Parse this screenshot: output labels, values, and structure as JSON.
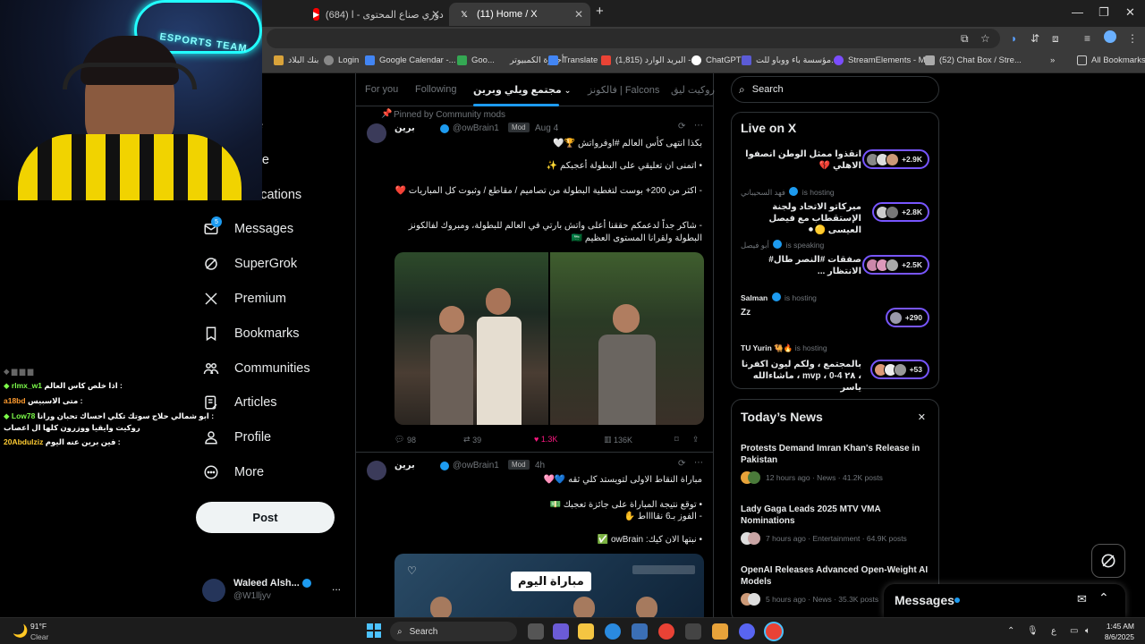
{
  "browser": {
    "tabs": [
      {
        "label": "(684) دوري صناع المحتوى - ا",
        "icon": "youtube-icon"
      },
      {
        "label": "(11) Home / X",
        "icon": "x-logo-icon"
      }
    ],
    "new_tab": "+",
    "bookmarks": [
      "بنك البلاد",
      "Login",
      "Google Calendar -...",
      "Goo...",
      "أجهزة الكمبيوتر",
      "Translate",
      "البريد الوارد (1,815) -...",
      "ChatGPT",
      "مؤسسة باء ووباو للت...",
      "StreamElements - M...",
      "(52) Chat Box / Stre...",
      "»",
      "All Bookmarks"
    ]
  },
  "nav": {
    "partial_items": [
      "e",
      "re",
      "ications"
    ],
    "items": [
      {
        "label": "Messages",
        "icon": "mail-icon",
        "badge": "5"
      },
      {
        "label": "SuperGrok",
        "icon": "grok-icon"
      },
      {
        "label": "Premium",
        "icon": "x-logo-icon"
      },
      {
        "label": "Bookmarks",
        "icon": "bookmark-icon"
      },
      {
        "label": "Communities",
        "icon": "communities-icon"
      },
      {
        "label": "Articles",
        "icon": "articles-icon"
      },
      {
        "label": "Profile",
        "icon": "profile-icon"
      },
      {
        "label": "More",
        "icon": "more-circle-icon"
      }
    ],
    "post_label": "Post",
    "account": {
      "name": "Waleed Alsh...",
      "handle": "@W1lljyv",
      "menu": "..."
    }
  },
  "feed": {
    "tabs": [
      "For you",
      "Following",
      "مجتمع ويلي وبرين",
      "فالكونز | Falcons",
      "روكيت ليق"
    ],
    "tweets": [
      {
        "pinned_label": "Pinned by Community mods",
        "name": "برين",
        "handle": "@owBrain1",
        "mod": "Mod",
        "time": "Aug 4",
        "lines": [
          "بكذا انتهى كأس العالم #اوفرواتش 🏆🤍",
          "• اتمنى ان تعليقي على البطولة أعجبكم ✨",
          "- اكثر من 200+ بوست لتغطية البطولة من تصاميم / مقاطع / وثبوت كل المباريات ❤️",
          "- شاكر جداً لدعمكم حققنا أعلى واتش بارتي في العالم للبطولة، ومبروك لفالكونز",
          "البطولة ولقرانا المستوى العظيم 🇸🇦"
        ],
        "replies": "98",
        "reposts": "39",
        "likes": "1.3K",
        "views": "136K"
      },
      {
        "name": "برين",
        "handle": "@owBrain1",
        "mod": "Mod",
        "time": "4h",
        "lines": [
          "مباراة النقاط الاولى لتويستد كلي ثقه 💙🩷",
          "• توقع نتيجة المباراة على جائزة تعجبك 💵",
          "- الفوز بـ6 نقااااط ✋",
          "• نبتها الان كيك: owBrain ✅"
        ],
        "card_title": "مباراة اليوم"
      }
    ]
  },
  "sidebar": {
    "search_placeholder": "Search",
    "live": {
      "title": "Live on X",
      "items": [
        {
          "host": "",
          "status": "",
          "title": "انقذوا ممثل الوطن انصفوا الاهلي 💔",
          "count": "+2.9K"
        },
        {
          "host": "فهد السحيباني",
          "status": "is hosting",
          "title": "ميركاتو الاتحاد ولجنة الإستقطاب مع فيصل العيسى 🟡⚫",
          "count": "+2.8K"
        },
        {
          "host": "أبو فيصل",
          "status": "is speaking",
          "title": "صفقات #النصر طال# الانتظار ...",
          "count": "+2.5K"
        },
        {
          "host": "Salman",
          "status": "is hosting",
          "title": "Zz",
          "count": "+290"
        },
        {
          "host": "TU Yurin 🐫🔥",
          "status": "is hosting",
          "title": "بالمجتمع ، ولكم ليون اكفرنا ، ٢٨ 4-0 ، mvp ، ماشاءالله ياسر",
          "count": "+53"
        }
      ]
    },
    "news": {
      "title": "Today’s News",
      "close": "✕",
      "items": [
        {
          "title": "Protests Demand Imran Khan's Release in Pakistan",
          "meta": "12 hours ago · News · 41.2K posts"
        },
        {
          "title": "Lady Gaga Leads 2025 MTV VMA Nominations",
          "meta": "7 hours ago · Entertainment · 64.9K posts"
        },
        {
          "title": "OpenAI Releases Advanced Open-Weight AI Models",
          "meta": "5 hours ago · News · 35.3K posts"
        }
      ]
    }
  },
  "messages_drawer": {
    "label": "Messages"
  },
  "stream_chat": [
    {
      "user": "rlmx_w1",
      "text": "اذا خلص كاس العالم :",
      "color": "#7cfc4a"
    },
    {
      "user": "a18bd",
      "text": "متى الاسبيس :",
      "color": "#ff9b2f"
    },
    {
      "user": "Low78",
      "text": "ابو شمالي حلاج سوتك تكلي احساك تحبان ورانا :",
      "color": "#7cfc4a"
    },
    {
      "user": "",
      "text": "روكيت وايقيا ووزرون كلها ال اعصاب",
      "color": "#ffffff"
    },
    {
      "user": "20Abdulziz",
      "text": "فين برين عنه اليوم :",
      "color": "#ffcc33"
    }
  ],
  "webcam": {
    "banner_text": "ESPORTS TEAM"
  },
  "taskbar": {
    "weather_temp": "91°F",
    "weather_text": "Clear",
    "search": "Search",
    "time": "1:45 AM",
    "date": "8/6/2025",
    "lang": "ع"
  },
  "colors": {
    "accent": "#1d9bf0",
    "like": "#f91880",
    "live_border": "#7856ff"
  }
}
